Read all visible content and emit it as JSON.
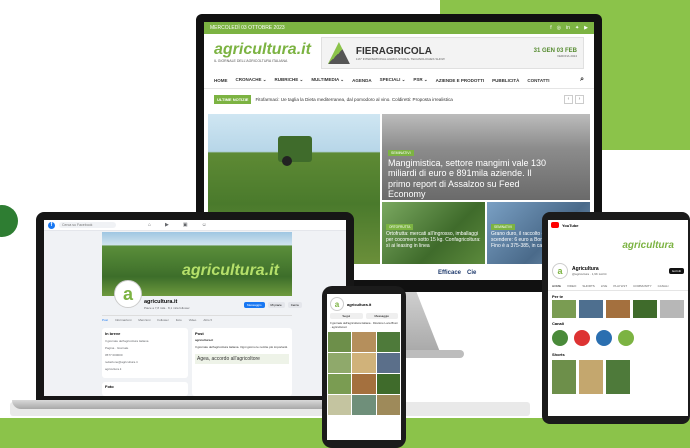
{
  "colors": {
    "brand_green": "#7cb342",
    "facebook_blue": "#1877f2",
    "youtube_red": "#ff0000"
  },
  "website": {
    "date": "MERCOLEDÌ 03 OTTOBRE 2023",
    "logo": "agricultura.it",
    "logo_tagline": "IL GIORNALE DELL'AGRICOLTURA ITALIANA",
    "banner": {
      "title": "FIERAGRICOLA",
      "subtitle": "116° INTERNATIONAL AGRICULTURAL TECHNOLOGIES SHOW",
      "date": "31 GEN 03 FEB",
      "location": "VERONA 2024"
    },
    "nav": [
      "HOME",
      "CRONACHE ⌄",
      "RUBRICHE ⌄",
      "MULTIMEDIA ⌄",
      "AGENDA",
      "SPECIALI ⌄",
      "PSR ⌄",
      "AZIENDE E PRODOTTI",
      "PUBBLICITÀ",
      "CONTATTI"
    ],
    "ticker_tag": "ULTIME NOTIZIE",
    "ticker_text": "Fitofarmaci: Ue taglia la Dieta mediterranea, dal pomodoro al vino. Coldiretti: Proposta irrealistica",
    "main_tag": "IN CAMPO",
    "top_story": {
      "tag": "SEMINATIVI",
      "title": "Mangimistica, settore mangimi vale 130 miliardi di euro e 891mila aziende. Il primo report di Assalzoo su Feed Economy"
    },
    "tile1": {
      "tag": "ORTOFRUTTA",
      "title": "Ortofrutta: mercati all’ingrosso, imballaggi per cocomero sotto 15 kg. Confagricoltura: sì ai leasing in linea"
    },
    "tile2": {
      "tag": "SEMINATIVI",
      "title": "Grano duro, il raccolto continua a scendere: 6 euro a Borsa Merci di Bari. Il Fino è a 375-385, in calo anche il biologico"
    },
    "ads": [
      "Efficace",
      "Cie"
    ]
  },
  "facebook": {
    "search_placeholder": "Cerca su Facebook",
    "cover_text": "agricultura.it",
    "page_name": "agricultura.it",
    "likes": "Piace a 7,8 mila · 8,1 mila follower",
    "buttons": [
      "Messaggio",
      "Mi piace",
      "Cerca"
    ],
    "tabs": [
      "Post",
      "Informazioni",
      "Menzioni",
      "Follower",
      "Foto",
      "Video",
      "Altro ▾"
    ],
    "intro_title": "In breve",
    "intro_lines": [
      "Il giornale dell'agricoltura italiana",
      "Pagina · Giornale",
      "0577 000000",
      "redazione@agricultura.it",
      "agricultura.it"
    ],
    "post_title": "Post",
    "post_author": "agricultura.it",
    "post_text": "Il giornale dell'agricoltura italiana. Ogni giorno le notizie più importanti.",
    "post_headline": "Agea, accordo all'agricoltore",
    "photos_title": "Foto"
  },
  "instagram": {
    "handle": "agricultura.it",
    "buttons": [
      "Segui",
      "Messaggio"
    ],
    "bio": "Il giornale dell'agricoltura italiana · Direttore Luca Bruni · agricultura.it"
  },
  "youtube": {
    "logo_word": "YouTube",
    "banner_logo": "agricultura",
    "channel_name": "Agricultura",
    "subscribers": "@agricultura · 1,9K iscritti",
    "subscribe": "Iscriviti",
    "tabs": [
      "HOME",
      "VIDEO",
      "SHORTS",
      "LIVE",
      "PLAYLIST",
      "COMMUNITY",
      "CANALI"
    ],
    "section_videos": "Per te",
    "section_channels": "Canali",
    "section_shorts": "Shorts"
  }
}
